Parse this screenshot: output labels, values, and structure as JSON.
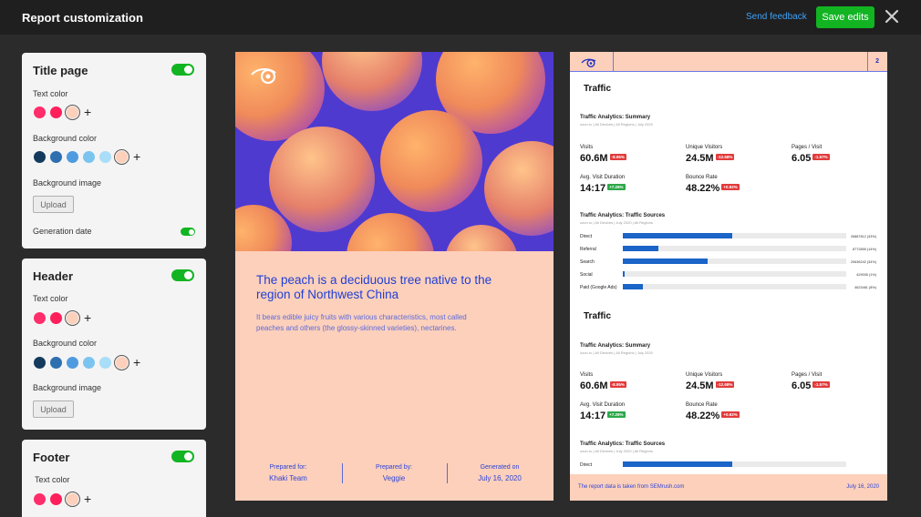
{
  "topbar": {
    "title": "Report customization",
    "feedback_label": "Send feedback",
    "save_label": "Save edits"
  },
  "colors": {
    "accent_green": "#12b422",
    "link_blue": "#3fa2f5",
    "peach": "#fdd0bb",
    "text_colors": [
      "#ff2d6a",
      "#ff1f5a",
      "#fdd0bb"
    ],
    "background_colors": [
      "#143a5e",
      "#2e6fb0",
      "#4f9be0",
      "#7cc4f0",
      "#a9ddf8",
      "#fdd0bb"
    ]
  },
  "panel": {
    "title_page": {
      "title": "Title page",
      "text_color_label": "Text color",
      "background_color_label": "Background color",
      "background_image_label": "Background image",
      "upload_label": "Upload",
      "generation_date_label": "Generation date"
    },
    "header": {
      "title": "Header",
      "text_color_label": "Text color",
      "background_color_label": "Background color",
      "background_image_label": "Background image",
      "upload_label": "Upload"
    },
    "footer": {
      "title": "Footer",
      "text_color_label": "Text color"
    },
    "plus": "+"
  },
  "page1": {
    "headline": "The peach is a deciduous tree native to the region of Northwest China",
    "subtext": "It bears edible juicy fruits with various characteristics, most called peaches and others (the glossy-skinned varieties), nectarines.",
    "prepared_for_label": "Prepared for:",
    "prepared_for_value": "Khaki Team",
    "prepared_by_label": "Prepared by:",
    "prepared_by_value": "Veggie",
    "generated_on_label": "Generated on",
    "generated_on_value": "July 16, 2020"
  },
  "page2": {
    "page_number": "2",
    "section_title": "Traffic",
    "summary_title": "Traffic Analytics: Summary",
    "summary_meta": "ozon.ru | All Devices | All Regions | July 2020",
    "metrics": [
      {
        "label": "Visits",
        "value": "60.6M",
        "delta": "-8.95%",
        "trend": "down"
      },
      {
        "label": "Unique Visitors",
        "value": "24.5M",
        "delta": "-12.68%",
        "trend": "down"
      },
      {
        "label": "Pages / Visit",
        "value": "6.05",
        "delta": "-1.57%",
        "trend": "down"
      },
      {
        "label": "Avg. Visit Duration",
        "value": "14:17",
        "delta": "+7.26%",
        "trend": "up"
      },
      {
        "label": "Bounce Rate",
        "value": "48.22%",
        "delta": "+0.92%",
        "trend": "down"
      }
    ],
    "sources_title": "Traffic Analytics: Traffic Sources",
    "sources_meta": "ozon.ru | All Devices | July 2020 | All Regions",
    "sources": [
      {
        "label": "Direct",
        "value": "26887812 (43%)",
        "share": 0.49
      },
      {
        "label": "Referral",
        "value": "8772855 (14%)",
        "share": 0.16
      },
      {
        "label": "Search",
        "value": "20636242 (34%)",
        "share": 0.38
      },
      {
        "label": "Social",
        "value": "429005 (1%)",
        "share": 0.01
      },
      {
        "label": "Paid (Google Ads)",
        "value": "4623461 (8%)",
        "share": 0.09
      }
    ],
    "footer_source": "The report data is taken from SEMrush.com",
    "footer_date": "July 16, 2020"
  }
}
